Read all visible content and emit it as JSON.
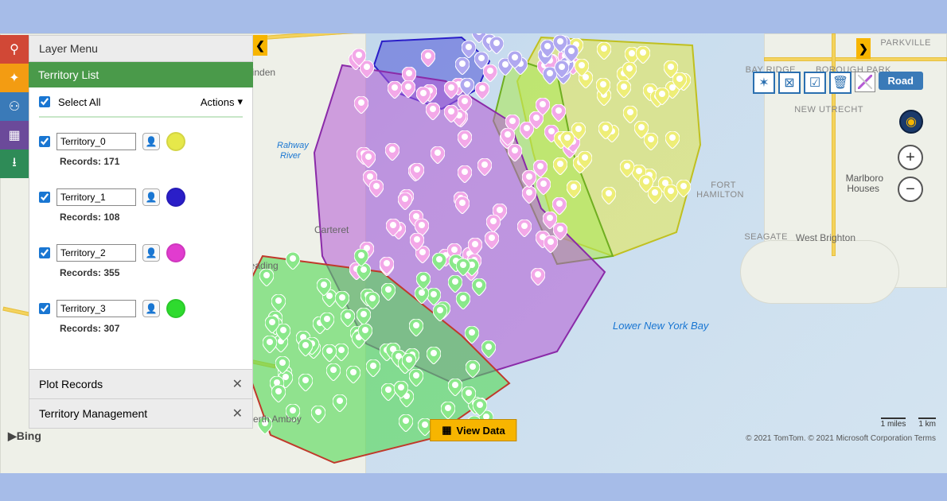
{
  "panel": {
    "layer_menu_title": "Layer Menu",
    "territory_list_title": "Territory List",
    "select_all_label": "Select All",
    "actions_label": "Actions",
    "plot_records_label": "Plot Records",
    "territory_mgmt_label": "Territory Management"
  },
  "territories": [
    {
      "name": "Territory_0",
      "records": "Records: 171",
      "checked": true,
      "color": "#e6e84a"
    },
    {
      "name": "Territory_1",
      "records": "Records: 108",
      "checked": true,
      "color": "#2a1ec8"
    },
    {
      "name": "Territory_2",
      "records": "Records: 355",
      "checked": true,
      "color": "#e13ccf"
    },
    {
      "name": "Territory_3",
      "records": "Records: 307",
      "checked": true,
      "color": "#2edb2e"
    }
  ],
  "map": {
    "mode_label": "Road",
    "water_label": "Lower New York Bay",
    "view_data_label": "View Data",
    "attribution": "© 2021 TomTom. © 2021 Microsoft Corporation  Terms",
    "scale_miles": "1 miles",
    "scale_km": "1 km",
    "bing_label": "Bing",
    "cities": [
      "Linden",
      "Carteret",
      "Reading",
      "Perth Amboy",
      "West Brighton"
    ],
    "parks": [
      "PARKVILLE",
      "BAY RIDGE",
      "BOROUGH PARK",
      "NEW UTRECHT",
      "SEAGATE",
      "Hamilton",
      "Fort"
    ],
    "extra_labels": [
      "Marlboro",
      "Houses",
      "Rahway",
      "River"
    ]
  },
  "toolbar": {
    "left_colors": [
      "#d14836",
      "#f39c12",
      "#3a7ab8",
      "#6b4a9a",
      "#2e8b57"
    ]
  }
}
